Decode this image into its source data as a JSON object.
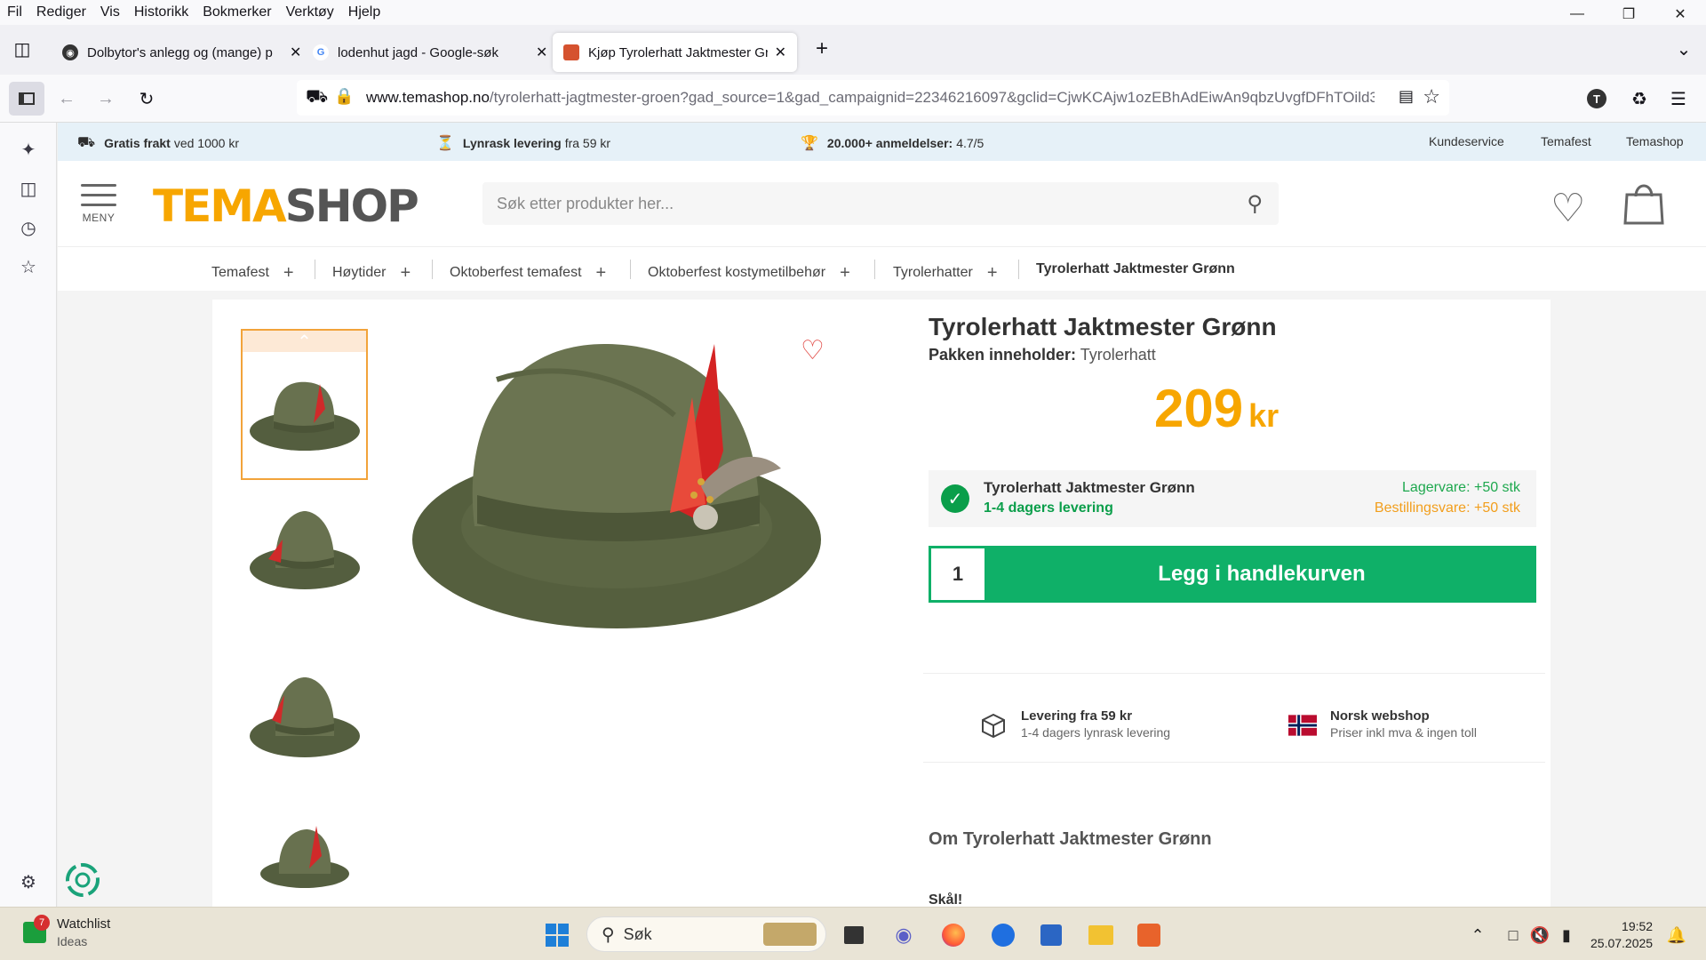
{
  "menubar": {
    "items": [
      "Fil",
      "Rediger",
      "Vis",
      "Historikk",
      "Bokmerker",
      "Verktøy",
      "Hjelp"
    ]
  },
  "tabs": [
    {
      "title": "Dolbytor's anlegg og (mange) p"
    },
    {
      "title": "lodenhut jagd - Google-søk"
    },
    {
      "title": "Kjøp Tyrolerhatt Jaktmester Grø"
    }
  ],
  "url": {
    "host": "www.temashop.no",
    "path": "/tyrolerhatt-jagtmester-groen?gad_source=1&gad_campaignid=22346216097&gclid=CjwKCAjw1ozEBhAdEiwAn9qbzUvgfDFhTOild3"
  },
  "topstrip": {
    "shipping_bold": "Gratis frakt",
    "shipping_rest": "ved 1000 kr",
    "delivery_bold": "Lynrask levering",
    "delivery_rest": "fra 59 kr",
    "reviews_bold": "20.000+ anmeldelser:",
    "reviews_rest": "4.7/5",
    "links": [
      "Kundeservice",
      "Temafest",
      "Temashop"
    ]
  },
  "header": {
    "menu_label": "MENY",
    "logo_a": "TEMA",
    "logo_b": "SHOP",
    "search_placeholder": "Søk etter produkter her..."
  },
  "breadcrumbs": [
    "Temafest",
    "Høytider",
    "Oktoberfest temafest",
    "Oktoberfest kostymetilbehør",
    "Tyrolerhatter",
    "Tyrolerhatt Jaktmester Grønn"
  ],
  "product": {
    "title": "Tyrolerhatt Jaktmester Grønn",
    "content_label": "Pakken inneholder:",
    "content_value": "Tyrolerhatt",
    "price": "209",
    "currency": "kr",
    "stock_name": "Tyrolerhatt Jaktmester Grønn",
    "delivery_time": "1-4 dagers levering",
    "stock_in": "Lagervare: +50 stk",
    "stock_order": "Bestillingsvare: +50 stk",
    "quantity": "1",
    "add_to_cart": "Legg i handlekurven"
  },
  "usp": [
    {
      "title": "Levering fra 59 kr",
      "sub": "1-4 dagers lynrask levering"
    },
    {
      "title": "Norsk webshop",
      "sub": "Priser inkl mva & ingen toll"
    }
  ],
  "about_title": "Om Tyrolerhatt Jaktmester Grønn",
  "about_first": "Skål!",
  "taskbar": {
    "watch_title": "Watchlist",
    "watch_sub": "Ideas",
    "watch_badge": "7",
    "search": "Søk",
    "time": "19:52",
    "date": "25.07.2025"
  },
  "colors": {
    "accent": "#f7a600",
    "cart_green": "#0fb068",
    "in_stock": "#1ea84e",
    "order_stock": "#f29e1c"
  }
}
